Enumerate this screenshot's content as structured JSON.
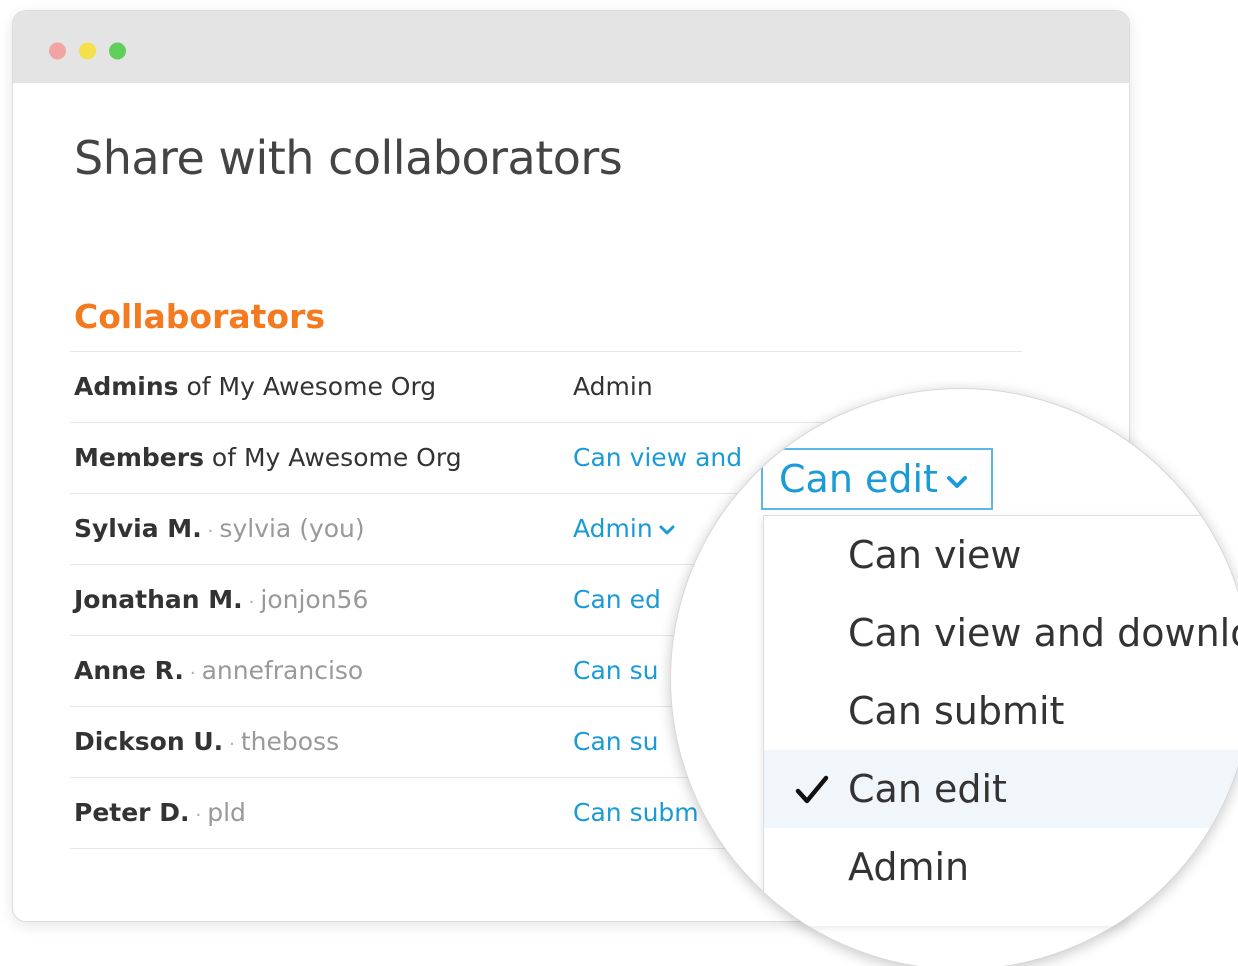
{
  "window": {
    "title": "Share with collaborators"
  },
  "section": {
    "title": "Collaborators"
  },
  "rows": [
    {
      "name_bold": "Admins",
      "name_rest": " of My Awesome Org",
      "username": "",
      "permission": "Admin",
      "editable": false
    },
    {
      "name_bold": "Members",
      "name_rest": " of My Awesome Org",
      "username": "",
      "permission": "Can view and",
      "editable": true
    },
    {
      "name_bold": "Sylvia M.",
      "name_rest": "",
      "username": "sylvia (you)",
      "permission": "Admin",
      "editable": true
    },
    {
      "name_bold": "Jonathan M.",
      "name_rest": "",
      "username": "jonjon56",
      "permission": "Can ed",
      "editable": true
    },
    {
      "name_bold": "Anne R.",
      "name_rest": "",
      "username": "annefranciso",
      "permission": "Can su",
      "editable": true
    },
    {
      "name_bold": "Dickson U.",
      "name_rest": "",
      "username": "theboss",
      "permission": "Can su",
      "editable": true
    },
    {
      "name_bold": "Peter D.",
      "name_rest": "",
      "username": "pld",
      "permission": "Can subm",
      "editable": true
    }
  ],
  "separator": "·",
  "dropdown": {
    "selected_label": "Can edit",
    "options": [
      {
        "label": "Can view",
        "selected": false
      },
      {
        "label": "Can view and downlo",
        "selected": false
      },
      {
        "label": "Can submit",
        "selected": false
      },
      {
        "label": "Can edit",
        "selected": true
      },
      {
        "label": "Admin",
        "selected": false
      }
    ]
  },
  "colors": {
    "accent_orange": "#f47a20",
    "link_blue": "#1a9ad6",
    "select_border": "#5bb8e6",
    "titlebar": "#e4e4e4",
    "dot_red": "#f2a3a3",
    "dot_yellow": "#f3e04a",
    "dot_green": "#5fcf5a"
  },
  "icons": {
    "chevron": "chevron-down-icon",
    "check": "checkmark-icon"
  }
}
